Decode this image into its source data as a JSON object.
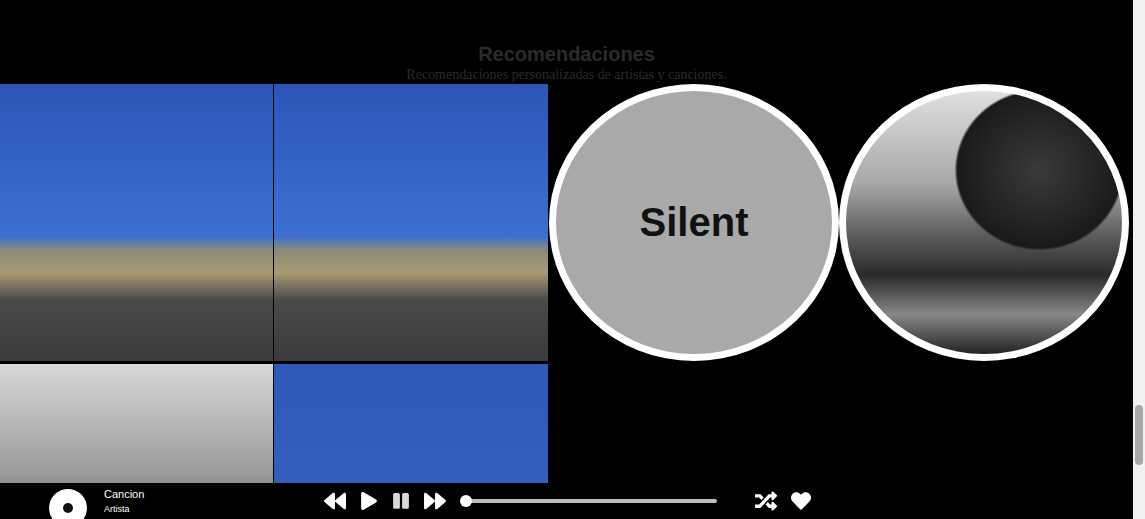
{
  "section": {
    "title": "Recomendaciones",
    "subtitle": "Recomendaciones personalizadas de artistas y canciones."
  },
  "tiles": [
    {
      "kind": "road"
    },
    {
      "kind": "road"
    },
    {
      "kind": "coast"
    },
    {
      "kind": "sky"
    }
  ],
  "circles": [
    {
      "kind": "text",
      "label": "Silent"
    },
    {
      "kind": "photo"
    }
  ],
  "player": {
    "song": "Cancion",
    "artist": "Artista",
    "playing": false,
    "level": 0,
    "liked": true
  },
  "scrollbar": {
    "level": 0.78
  }
}
